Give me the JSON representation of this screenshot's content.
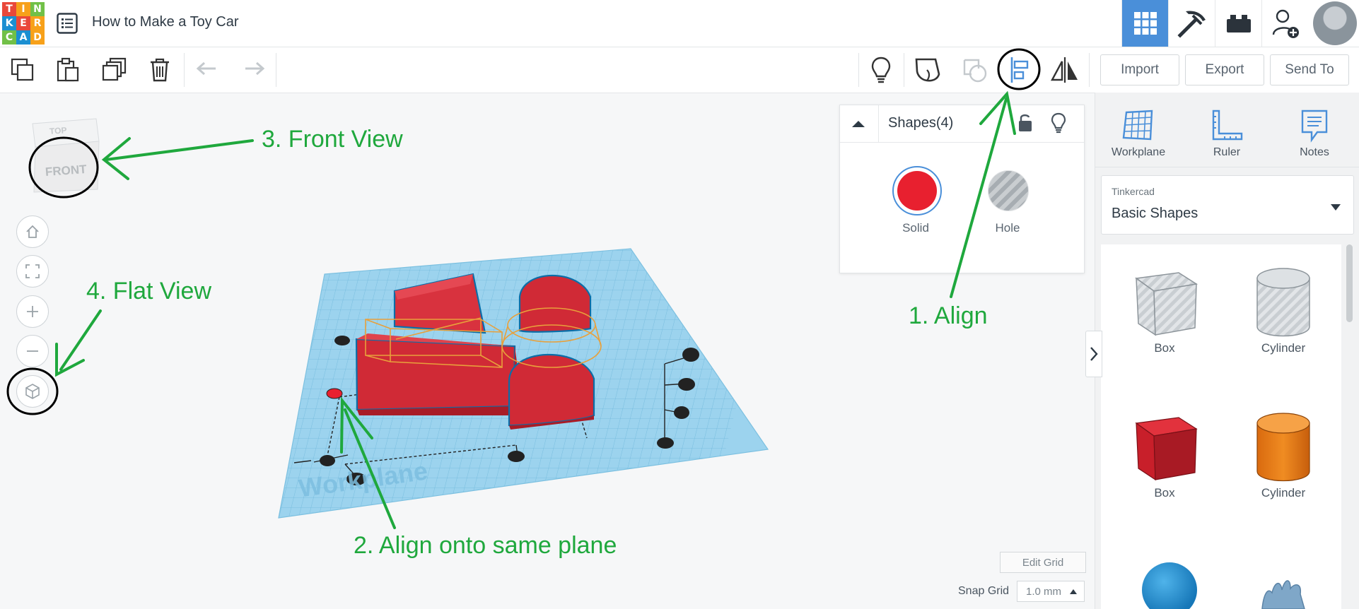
{
  "app": {
    "logo_letters": [
      "T",
      "I",
      "N",
      "K",
      "E",
      "R",
      "C",
      "A",
      "D"
    ],
    "logo_colors": [
      "#e9483a",
      "#f7a11a",
      "#71c047",
      "#1b8fd1",
      "#e9483a",
      "#f7a11a",
      "#71c047",
      "#1b8fd1",
      "#f7a11a"
    ],
    "design_title": "How to Make a Toy Car"
  },
  "header": {
    "icons": [
      "3d-design-grid-icon",
      "pickaxe-icon",
      "brick-icon",
      "add-user-icon",
      "avatar"
    ]
  },
  "toolbar": {
    "left_icons": [
      "copy-icon",
      "paste-icon",
      "duplicate-icon",
      "delete-icon",
      "undo-icon",
      "redo-icon"
    ],
    "right_icons": [
      "light-bulb-icon",
      "note-shape-icon",
      "group-icon",
      "align-icon",
      "mirror-icon"
    ],
    "import_label": "Import",
    "export_label": "Export",
    "send_to_label": "Send To"
  },
  "viewcube": {
    "top_label": "TOP",
    "front_label": "FRONT"
  },
  "view_controls": [
    "home-icon",
    "fit-view-icon",
    "zoom-in-icon",
    "zoom-out-icon",
    "ortho-view-icon"
  ],
  "inspector": {
    "title": "Shapes(4)",
    "solid_label": "Solid",
    "hole_label": "Hole",
    "solid_color": "#e8202f"
  },
  "workplane": {
    "label": "Workplane",
    "edit_grid_label": "Edit Grid",
    "snap_grid_label": "Snap Grid",
    "snap_grid_value": "1.0 mm"
  },
  "right_panel": {
    "tools": [
      {
        "label": "Workplane",
        "icon": "workplane-icon"
      },
      {
        "label": "Ruler",
        "icon": "ruler-icon"
      },
      {
        "label": "Notes",
        "icon": "notes-icon"
      }
    ],
    "library_source": "Tinkercad",
    "library_name": "Basic Shapes",
    "shapes": [
      {
        "label": "Box",
        "icon": "box-hole-icon"
      },
      {
        "label": "Cylinder",
        "icon": "cylinder-hole-icon"
      },
      {
        "label": "Box",
        "icon": "box-solid-icon"
      },
      {
        "label": "Cylinder",
        "icon": "cylinder-solid-icon"
      }
    ]
  },
  "annotations": {
    "a1": "1. Align",
    "a2": "2. Align onto same plane",
    "a3": "3. Front View",
    "a4": "4. Flat View",
    "color": "#1fa83d"
  }
}
